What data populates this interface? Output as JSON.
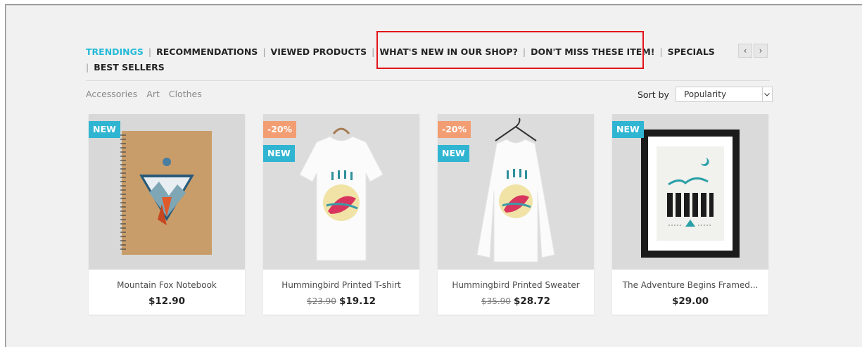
{
  "tabs": [
    {
      "label": "TRENDINGS",
      "active": true
    },
    {
      "label": "RECOMMENDATIONS",
      "active": false
    },
    {
      "label": "VIEWED PRODUCTS",
      "active": false
    },
    {
      "label": "WHAT'S NEW IN OUR SHOP?",
      "active": false
    },
    {
      "label": "DON'T MISS THESE ITEM!",
      "active": false
    },
    {
      "label": "SPECIALS",
      "active": false
    },
    {
      "label": "BEST SELLERS",
      "active": false
    }
  ],
  "nav": {
    "prev_icon": "chevron-left-icon",
    "next_icon": "chevron-right-icon",
    "prev_glyph": "‹",
    "next_glyph": "›"
  },
  "categories": [
    "Accessories",
    "Art",
    "Clothes"
  ],
  "sort": {
    "label": "Sort by",
    "value": "Popularity"
  },
  "products": [
    {
      "name": "Mountain Fox Notebook",
      "old_price": "",
      "price": "$12.90",
      "badges": [
        "NEW"
      ]
    },
    {
      "name": "Hummingbird Printed T-shirt",
      "old_price": "$23.90",
      "price": "$19.12",
      "badges": [
        "-20%",
        "NEW"
      ]
    },
    {
      "name": "Hummingbird Printed Sweater",
      "old_price": "$35.90",
      "price": "$28.72",
      "badges": [
        "-20%",
        "NEW"
      ]
    },
    {
      "name": "The Adventure Begins Framed...",
      "old_price": "",
      "price": "$29.00",
      "badges": [
        "NEW"
      ]
    }
  ],
  "colors": {
    "accent": "#24b9d7",
    "new_badge": "#2fb5d2",
    "discount_badge": "#f39d72",
    "highlight": "#e3141b"
  }
}
